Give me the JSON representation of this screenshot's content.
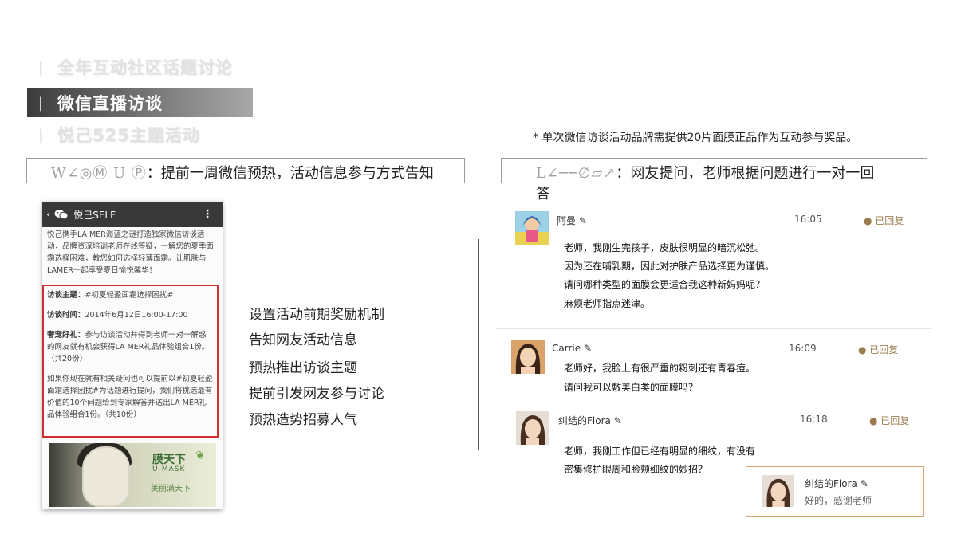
{
  "nav": [
    {
      "label": "全年互动社区话题讨论",
      "active": false
    },
    {
      "label": "微信直播访谈",
      "active": true
    },
    {
      "label": "悦己525主题活动",
      "active": false
    }
  ],
  "nav_bar_char": "|",
  "note": "*  单次微信访谈活动品牌需提供20片面膜正品作为互动参与奖品。",
  "left_header": {
    "glyphs": "W∠◎Ⓜ  U Ⓟ",
    "text": "：提前一周微信预热，活动信息参与方式告知"
  },
  "right_header": {
    "glyphs": "L∠──∅▱↗",
    "text": "：网友提问，老师根据问题进行一对一回",
    "wrap": "答"
  },
  "phone": {
    "back": "‹",
    "title": "悦己SELF",
    "more": "⋮",
    "intro": "悦己携手LA MER海蓝之谜打造独家微信访谈活动，品牌资深培训老师在线答疑，一解您的夏季面霜选择困难，教您如何选择轻薄面霜。让肌肤与LAMER一起享受夏日愉悦馨华！",
    "topic_label": "访谈主题：",
    "topic": "#初夏轻盈面霜选择困扰#",
    "time_label": "访谈时间：",
    "time": "2014年6月12日16:00-17:00",
    "gift_label": "奢宠好礼：",
    "gift": "参与访谈活动并得到老师一对一解惑的网友就有机会获得LA MER礼品体验组合1份。（共20份）",
    "extra": "如果你现在就有相关疑问也可以提前以#初夏轻盈面霜选择困扰#为话题进行提问，我们将挑选最有价值的10个问题给到专家解答并送出LA MER礼品体验组合1份。（共10份）",
    "ad_title": "膜天下",
    "ad_sub": "U-MASK",
    "ad_sub2": "美丽满天下",
    "ad_leaf": "❦"
  },
  "features": [
    "设置活动前期奖励机制",
    "告知网友活动信息",
    "预热推出访谈主题",
    "提前引发网友参与讨论",
    "预热造势招募人气"
  ],
  "comments": [
    {
      "name": "阿曼",
      "time": "16:05",
      "status": "● 已回复",
      "lines": [
        "老师，我刚生完孩子，皮肤很明显的暗沉松弛。",
        "因为还在哺乳期，因此对护肤产品选择更为谨慎。",
        "请问哪种类型的面膜会更适合我这种新妈妈呢？",
        "麻烦老师指点迷津。"
      ]
    },
    {
      "name": "Carrie",
      "time": "16:09",
      "status": "● 已回复",
      "lines": [
        "老师好，我脸上有很严重的粉刺还有青春痘。",
        "请问我可以敷美白类的面膜吗？"
      ]
    },
    {
      "name": "纠结的Flora",
      "time": "16:18",
      "status": "● 已回复",
      "lines": [
        "老师，我刚工作但已经有明显的细纹，有没有",
        "密集修护眼周和脸颊细纹的妙招？"
      ]
    }
  ],
  "edit_icon": "✎",
  "reply": {
    "name": "纠结的Flora",
    "text": "好的，感谢老师"
  },
  "colors": {
    "accent_red": "#d23030",
    "status_gold": "#9a7d4e",
    "reply_border": "#d9a672"
  }
}
